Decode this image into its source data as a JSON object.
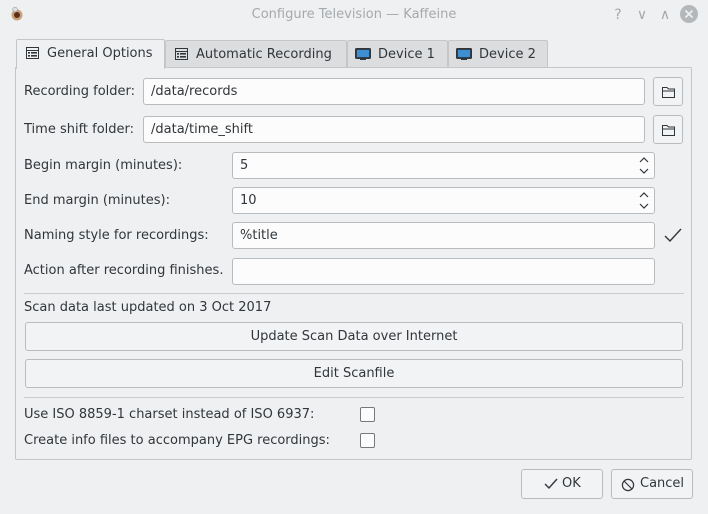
{
  "window": {
    "title": "Configure Television — Kaffeine",
    "help_glyph": "?",
    "minimize_glyph": "∨",
    "maximize_glyph": "∧",
    "app_icon": "kaffeine-icon"
  },
  "tabs": [
    {
      "label": "General Options",
      "icon": "settings-list-icon",
      "active": true
    },
    {
      "label": "Automatic Recording",
      "icon": "settings-list-icon",
      "active": false
    },
    {
      "label": "Device 1",
      "icon": "tv-device-icon",
      "active": false
    },
    {
      "label": "Device 2",
      "icon": "tv-device-icon",
      "active": false
    }
  ],
  "general": {
    "recording_folder": {
      "label": "Recording folder:",
      "value": "/data/records"
    },
    "time_shift_folder": {
      "label": "Time shift folder:",
      "value": "/data/time_shift"
    },
    "begin_margin": {
      "label": "Begin margin (minutes):",
      "value": "5"
    },
    "end_margin": {
      "label": "End margin (minutes):",
      "value": "10"
    },
    "naming_style": {
      "label": "Naming style for recordings:",
      "value": "%title"
    },
    "action_after": {
      "label": "Action after recording finishes.",
      "value": ""
    },
    "scan_status": "Scan data last updated on 3 Oct 2017",
    "update_scan_button": "Update Scan Data over Internet",
    "edit_scanfile_button": "Edit Scanfile",
    "iso_charset": {
      "label": "Use ISO 8859-1 charset instead of ISO 6937:",
      "checked": false
    },
    "info_files": {
      "label": "Create info files to accompany EPG recordings:",
      "checked": false
    }
  },
  "buttons": {
    "ok": "OK",
    "cancel": "Cancel"
  },
  "colors": {
    "background": "#eff0f1",
    "valid_check": "#31363b",
    "close_circle": "#b5b8ba"
  }
}
